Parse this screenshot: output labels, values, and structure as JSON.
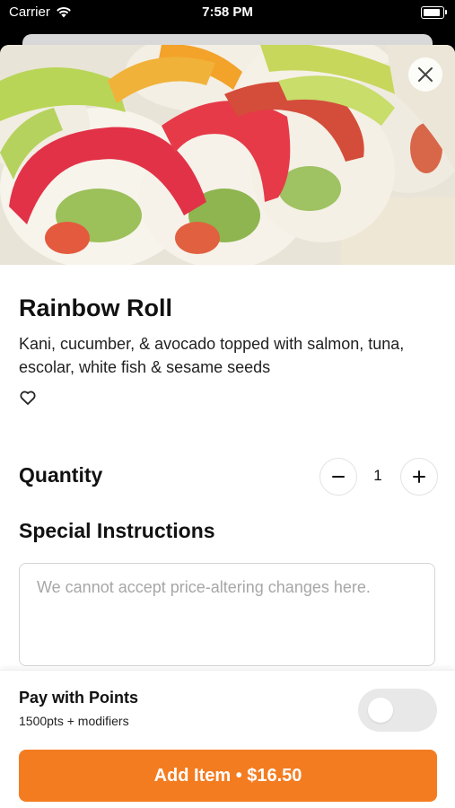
{
  "status_bar": {
    "carrier": "Carrier",
    "time": "7:58 PM"
  },
  "item": {
    "name": "Rainbow Roll",
    "description": "Kani, cucumber, & avocado topped with salmon, tuna, escolar, white fish & sesame seeds",
    "image_icon": "sushi-roll-photo"
  },
  "quantity": {
    "label": "Quantity",
    "value": "1",
    "decrement_icon": "minus-icon",
    "increment_icon": "plus-icon"
  },
  "special_instructions": {
    "label": "Special Instructions",
    "placeholder": "We cannot accept price-altering changes here.",
    "value": ""
  },
  "points": {
    "title": "Pay with Points",
    "subtitle": "1500pts + modifiers",
    "enabled": false
  },
  "add_button": {
    "label": "Add Item • $16.50"
  },
  "colors": {
    "accent": "#f47c20",
    "toggle_off": "#e8e8e8"
  }
}
